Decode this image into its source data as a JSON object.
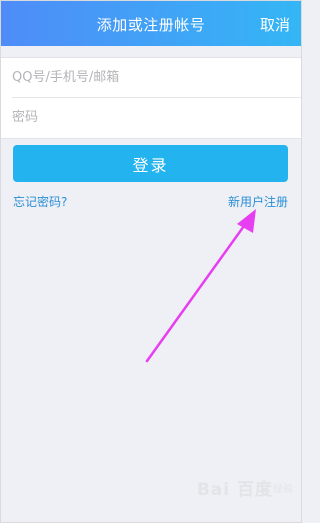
{
  "header": {
    "title": "添加或注册帐号",
    "cancel_label": "取消"
  },
  "form": {
    "account_placeholder": "QQ号/手机号/邮箱",
    "password_placeholder": "密码",
    "login_label": "登录"
  },
  "links": {
    "forgot_password": "忘记密码?",
    "register": "新用户注册"
  },
  "watermark": {
    "text": "Bai 百度",
    "sub": "经验"
  },
  "colors": {
    "header_start": "#4f8cf8",
    "header_end": "#34b6f5",
    "button": "#23b3ee",
    "link": "#2a8fd6",
    "annotation_arrow": "#e63ef0"
  }
}
